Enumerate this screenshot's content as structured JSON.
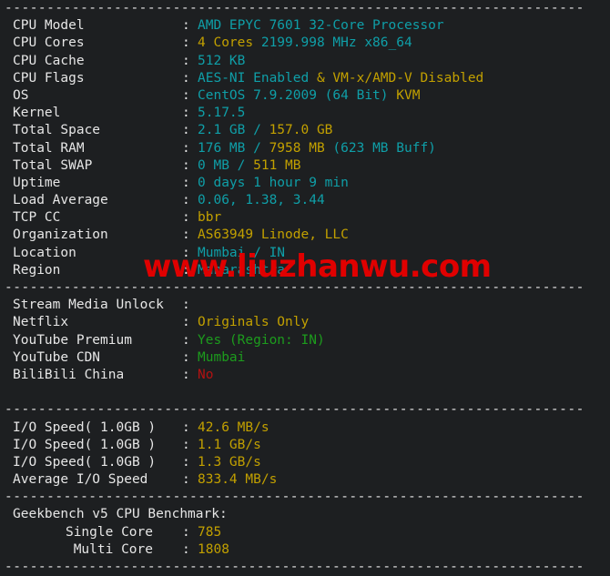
{
  "terminal": {
    "separator": "---------------------------------------------------------------------",
    "colon": ":",
    "watermark": "www.liuzhanwu.com"
  },
  "sections": {
    "system": [
      {
        "label": "CPU Model",
        "parts": [
          {
            "t": "AMD EPYC 7601 32-Core Processor",
            "c": "cy"
          }
        ]
      },
      {
        "label": "CPU Cores",
        "parts": [
          {
            "t": "4 Cores",
            "c": "or"
          },
          {
            "t": " 2199.998 MHz x86_64",
            "c": "cy"
          }
        ]
      },
      {
        "label": "CPU Cache",
        "parts": [
          {
            "t": "512 KB",
            "c": "cy"
          }
        ]
      },
      {
        "label": "CPU Flags",
        "parts": [
          {
            "t": "AES-NI Enabled",
            "c": "cy"
          },
          {
            "t": " & ",
            "c": "or"
          },
          {
            "t": "VM-x/AMD-V Disabled",
            "c": "or"
          }
        ]
      },
      {
        "label": "OS",
        "parts": [
          {
            "t": "CentOS 7.9.2009 (64 Bit)",
            "c": "cy"
          },
          {
            "t": " KVM",
            "c": "or"
          }
        ]
      },
      {
        "label": "Kernel",
        "parts": [
          {
            "t": "5.17.5",
            "c": "cy"
          }
        ]
      },
      {
        "label": "Total Space",
        "parts": [
          {
            "t": "2.1 GB / ",
            "c": "cy"
          },
          {
            "t": "157.0 GB",
            "c": "or"
          }
        ]
      },
      {
        "label": "Total RAM",
        "parts": [
          {
            "t": "176 MB / ",
            "c": "cy"
          },
          {
            "t": "7958 MB",
            "c": "or"
          },
          {
            "t": " (623 MB Buff)",
            "c": "cy"
          }
        ]
      },
      {
        "label": "Total SWAP",
        "parts": [
          {
            "t": "0 MB / ",
            "c": "cy"
          },
          {
            "t": "511 MB",
            "c": "or"
          }
        ]
      },
      {
        "label": "Uptime",
        "parts": [
          {
            "t": "0 days 1 hour 9 min",
            "c": "cy"
          }
        ]
      },
      {
        "label": "Load Average",
        "parts": [
          {
            "t": "0.06, 1.38, 3.44",
            "c": "cy"
          }
        ]
      },
      {
        "label": "TCP CC",
        "parts": [
          {
            "t": "bbr",
            "c": "or"
          }
        ]
      },
      {
        "label": "Organization",
        "parts": [
          {
            "t": "AS63949 Linode, LLC",
            "c": "or"
          }
        ]
      },
      {
        "label": "Location",
        "parts": [
          {
            "t": "Mumbai / IN",
            "c": "cy"
          }
        ]
      },
      {
        "label": "Region",
        "parts": [
          {
            "t": "Maharashtra",
            "c": "cy"
          }
        ]
      }
    ],
    "stream": [
      {
        "label": "Stream Media Unlock",
        "parts": []
      },
      {
        "label": "Netflix",
        "parts": [
          {
            "t": "Originals Only",
            "c": "or"
          }
        ]
      },
      {
        "label": "YouTube Premium",
        "parts": [
          {
            "t": "Yes (Region: IN)",
            "c": "gr"
          }
        ]
      },
      {
        "label": "YouTube CDN",
        "parts": [
          {
            "t": "Mumbai",
            "c": "gr"
          }
        ]
      },
      {
        "label": "BiliBili China",
        "parts": [
          {
            "t": "No",
            "c": "rd"
          }
        ]
      }
    ],
    "io": [
      {
        "label": "I/O Speed( 1.0GB )",
        "parts": [
          {
            "t": "42.6 MB/s",
            "c": "or"
          }
        ]
      },
      {
        "label": "I/O Speed( 1.0GB )",
        "parts": [
          {
            "t": "1.1 GB/s",
            "c": "or"
          }
        ]
      },
      {
        "label": "I/O Speed( 1.0GB )",
        "parts": [
          {
            "t": "1.3 GB/s",
            "c": "or"
          }
        ]
      },
      {
        "label": "Average I/O Speed",
        "parts": [
          {
            "t": "833.4 MB/s",
            "c": "or"
          }
        ]
      }
    ],
    "geekbench": {
      "heading": "Geekbench v5 CPU Benchmark:",
      "rows": [
        {
          "label": "Single Core",
          "parts": [
            {
              "t": "785",
              "c": "or"
            }
          ]
        },
        {
          "label": "Multi Core",
          "parts": [
            {
              "t": "1808",
              "c": "or"
            }
          ]
        }
      ]
    }
  }
}
